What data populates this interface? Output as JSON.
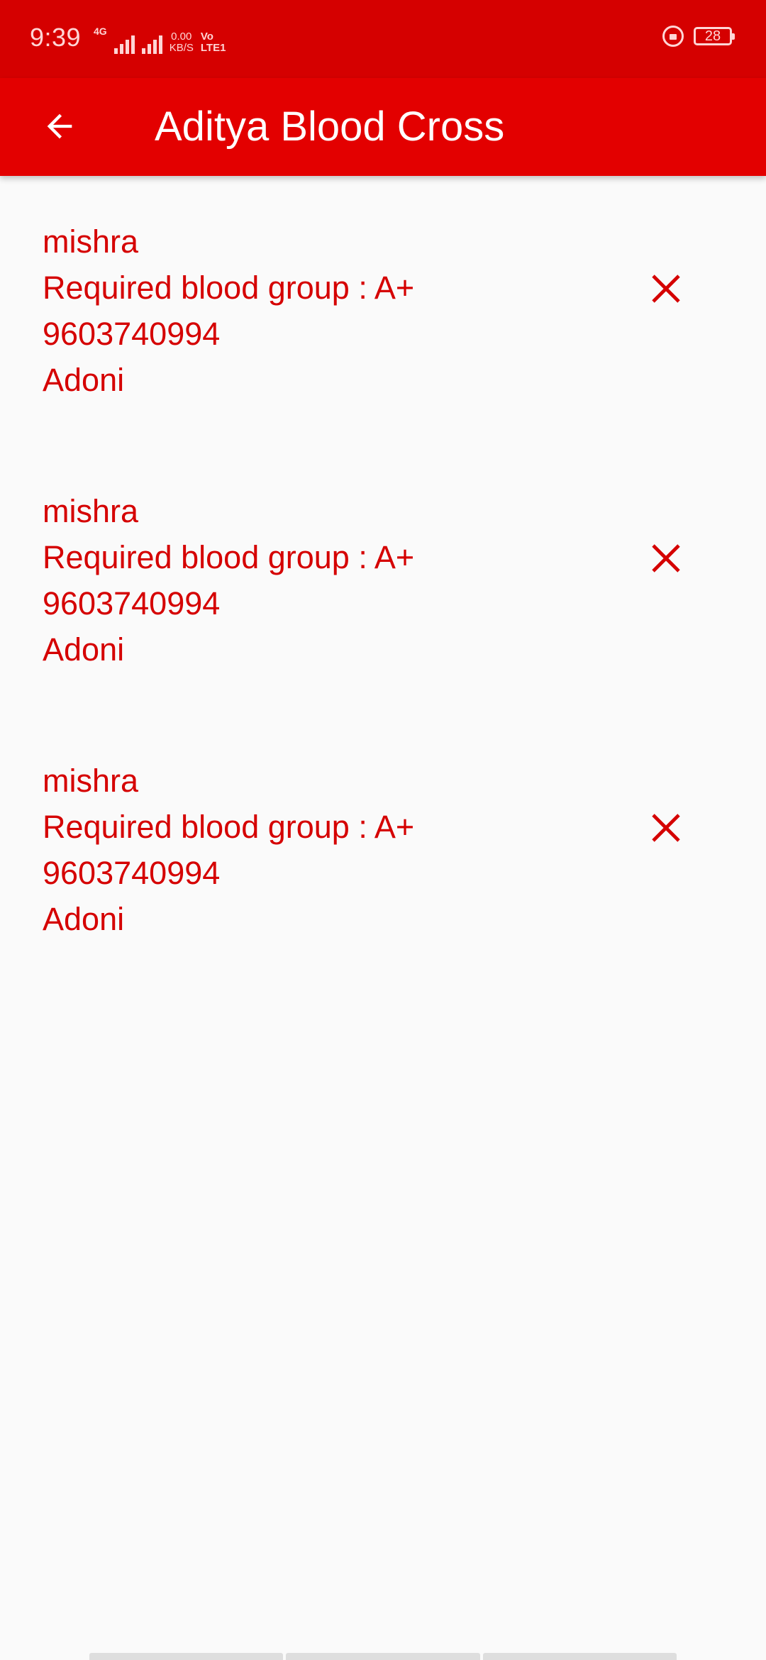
{
  "status_bar": {
    "time": "9:39",
    "network_type": "4G",
    "data_speed_value": "0.00",
    "data_speed_unit": "KB/S",
    "volte_top": "Vo",
    "volte_bottom": "LTE1",
    "battery_level": "28"
  },
  "app_bar": {
    "title": "Aditya Blood Cross",
    "back_icon": "arrow-left-icon"
  },
  "requests": [
    {
      "name": "mishra",
      "blood_group_line": "Required blood group : A+",
      "phone": "9603740994",
      "location": "Adoni",
      "action_icon": "close-icon"
    },
    {
      "name": "mishra",
      "blood_group_line": "Required blood group : A+",
      "phone": "9603740994",
      "location": "Adoni",
      "action_icon": "close-icon"
    },
    {
      "name": "mishra",
      "blood_group_line": "Required blood group : A+",
      "phone": "9603740994",
      "location": "Adoni",
      "action_icon": "close-icon"
    }
  ],
  "colors": {
    "status_bar": "#d50000",
    "app_bar": "#e30000",
    "accent_text": "#d50000",
    "background": "#fafafa"
  }
}
